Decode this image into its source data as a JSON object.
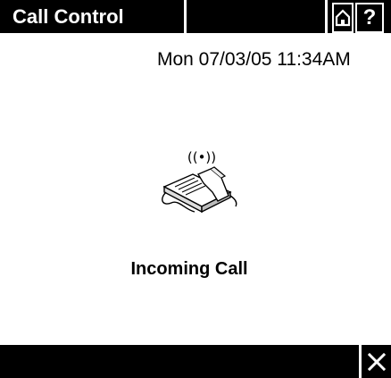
{
  "header": {
    "title": "Call Control",
    "home_icon": "home-icon",
    "help_label": "?"
  },
  "main": {
    "datetime": "Mon 07/03/05 11:34AM",
    "status_icon": "ringing-phone-icon",
    "status": "Incoming Call"
  },
  "footer": {
    "close_icon": "close-icon"
  },
  "colors": {
    "bar": "#000000",
    "background": "#ffffff",
    "bar_text": "#ffffff"
  }
}
